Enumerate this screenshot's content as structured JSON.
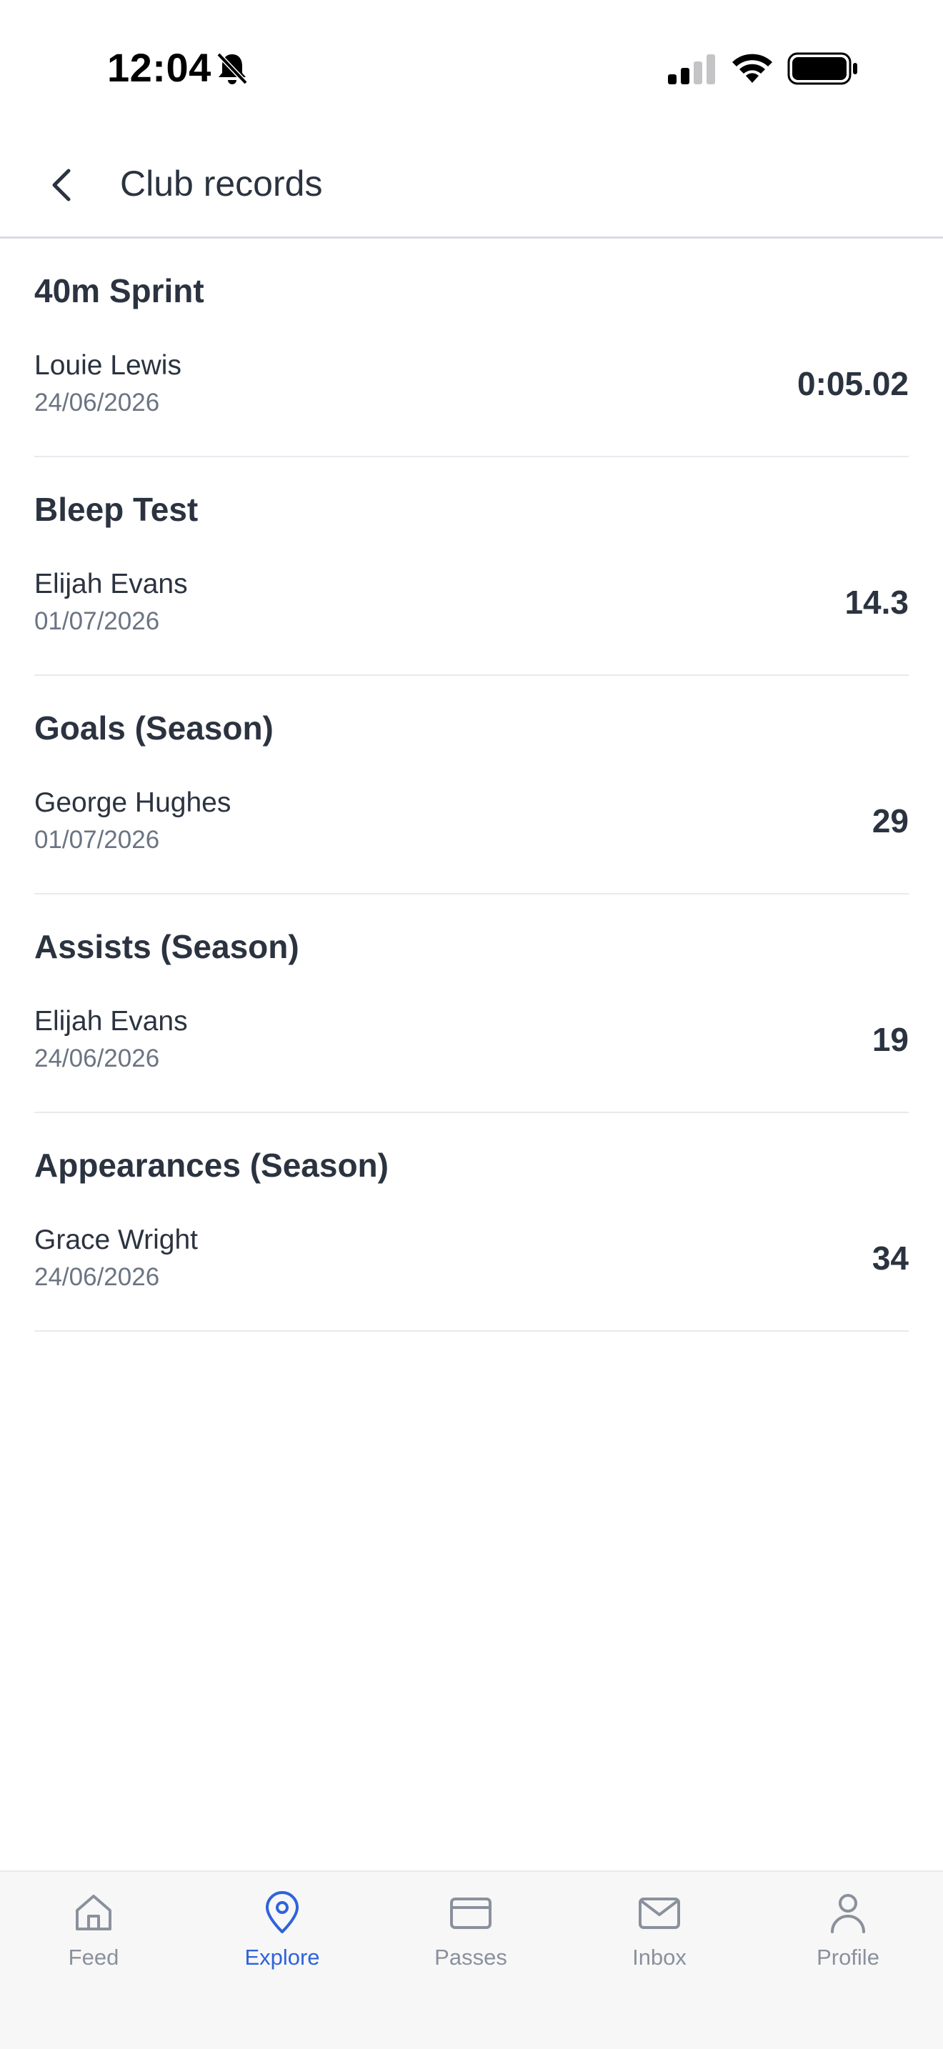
{
  "status_bar": {
    "time": "12:04",
    "icons": [
      "bell-slash-icon",
      "cellular-signal-icon",
      "wifi-icon",
      "battery-icon"
    ]
  },
  "header": {
    "title": "Club records",
    "back_icon": "chevron-left-icon"
  },
  "records": [
    {
      "title": "40m Sprint",
      "holder": "Louie Lewis",
      "date": "24/06/2026",
      "value": "0:05.02"
    },
    {
      "title": "Bleep Test",
      "holder": "Elijah Evans",
      "date": "01/07/2026",
      "value": "14.3"
    },
    {
      "title": "Goals (Season)",
      "holder": "George Hughes",
      "date": "01/07/2026",
      "value": "29"
    },
    {
      "title": "Assists (Season)",
      "holder": "Elijah Evans",
      "date": "24/06/2026",
      "value": "19"
    },
    {
      "title": "Appearances (Season)",
      "holder": "Grace Wright",
      "date": "24/06/2026",
      "value": "34"
    }
  ],
  "tab_bar": {
    "active": "Explore",
    "tabs": [
      {
        "label": "Feed",
        "icon": "home-icon"
      },
      {
        "label": "Explore",
        "icon": "map-pin-icon"
      },
      {
        "label": "Passes",
        "icon": "card-icon"
      },
      {
        "label": "Inbox",
        "icon": "mail-icon"
      },
      {
        "label": "Profile",
        "icon": "user-icon"
      }
    ]
  },
  "colors": {
    "text_primary": "#2b3340",
    "text_secondary": "#6b7482",
    "accent": "#2f63d9",
    "tab_inactive": "#8a919c",
    "divider": "#e8eaee"
  }
}
